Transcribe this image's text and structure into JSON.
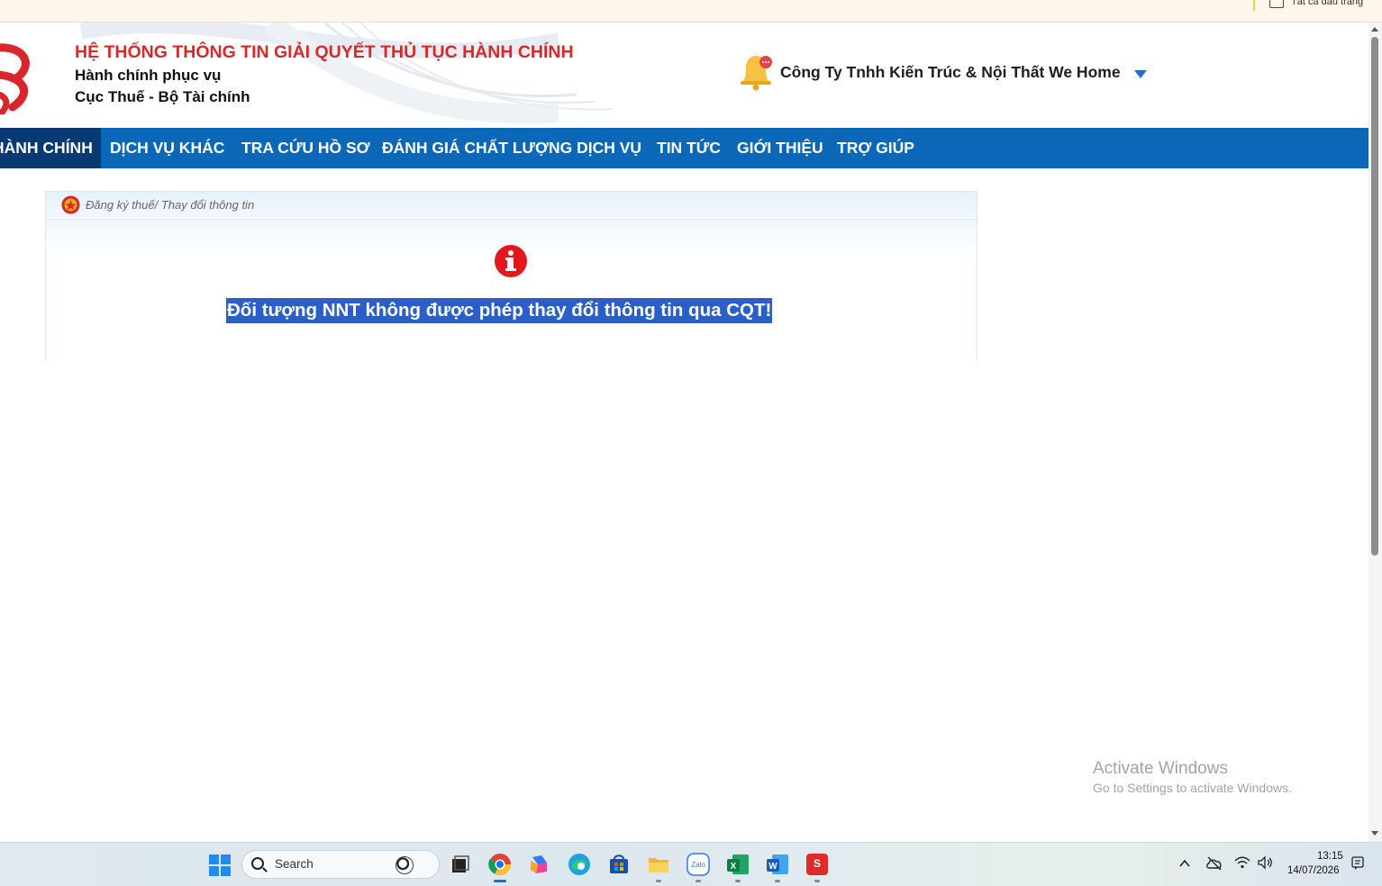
{
  "bookmarks_bar": {
    "all_bookmarks_label": "Tất cả dấu trang"
  },
  "header": {
    "title": "HỆ THỐNG THÔNG TIN GIẢI QUYẾT THỦ TỤC HÀNH CHÍNH",
    "subtitle_1": "Hành chính phục vụ",
    "subtitle_2": "Cục Thuế - Bộ Tài chính",
    "company_name": "Công Ty Tnhh Kiến Trúc & Nội Thất We Home",
    "title_color": "#d42a2a"
  },
  "nav": {
    "background": "#0b68b8",
    "items": [
      {
        "label": "HÀNH CHÍNH",
        "active": true
      },
      {
        "label": "DỊCH VỤ KHÁC",
        "active": false
      },
      {
        "label": "TRA CỨU HỒ SƠ",
        "active": false
      },
      {
        "label": "ĐÁNH GIÁ CHẤT LƯỢNG DỊCH VỤ",
        "active": false
      },
      {
        "label": "TIN TỨC",
        "active": false
      },
      {
        "label": "GIỚI THIỆU",
        "active": false
      },
      {
        "label": "TRỢ GIÚP",
        "active": false
      }
    ]
  },
  "panel": {
    "breadcrumb": "Đăng ký thuế/ Thay đổi thông tin",
    "message": "Đối tượng NNT không được phép thay đổi thông tin qua CQT!",
    "message_highlight": "#2a5ec9",
    "icon": "info-icon"
  },
  "watermark": {
    "title": "Activate Windows",
    "subtitle": "Go to Settings to activate Windows."
  },
  "taskbar": {
    "search_label": "Search",
    "apps": [
      "start-icon",
      "task-view-icon",
      "chrome-icon",
      "copilot-icon",
      "edge-icon",
      "store-icon",
      "file-explorer-icon",
      "zalo-icon",
      "excel-icon",
      "word-icon",
      "invoice-app-icon"
    ],
    "time": "13:15",
    "date": "14/07/2026"
  }
}
